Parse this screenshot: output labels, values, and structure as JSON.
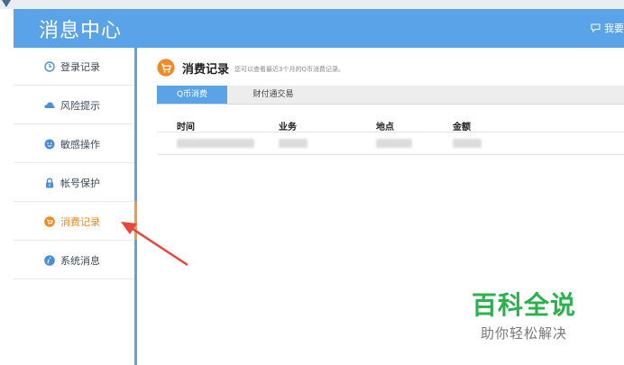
{
  "header": {
    "title": "消息中心",
    "right_text": "我要"
  },
  "sidebar": {
    "items": [
      {
        "label": "登录记录",
        "icon": "clock-icon",
        "active": false
      },
      {
        "label": "风险提示",
        "icon": "cloud-icon",
        "active": false
      },
      {
        "label": "敏感操作",
        "icon": "smiley-icon",
        "active": false
      },
      {
        "label": "帐号保护",
        "icon": "lock-icon",
        "active": false
      },
      {
        "label": "消费记录",
        "icon": "cart-icon",
        "active": true
      },
      {
        "label": "系统消息",
        "icon": "info-icon",
        "active": false
      }
    ]
  },
  "section": {
    "title": "消费记录",
    "description": "您可以查看最近3个月的Q币消费记录。"
  },
  "tabs": [
    {
      "label": "Q币消费",
      "active": true
    },
    {
      "label": "财付通交易",
      "active": false
    }
  ],
  "table": {
    "columns": [
      "时间",
      "业务",
      "地点",
      "金额"
    ]
  },
  "watermark": {
    "main": "百科全说",
    "sub": "助你轻松解决"
  },
  "colors": {
    "accent": "#5aa3e8",
    "active": "#f08a24",
    "annotation_arrow": "#e8453c",
    "watermark": "#2bb24c"
  }
}
